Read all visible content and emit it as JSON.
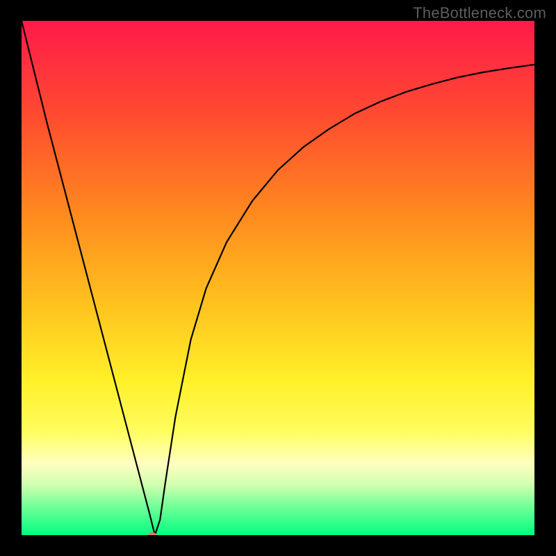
{
  "watermark": "TheBottleneck.com",
  "chart_data": {
    "type": "line",
    "title": "",
    "xlabel": "",
    "ylabel": "",
    "xlim": [
      0,
      100
    ],
    "ylim": [
      0,
      100
    ],
    "grid": false,
    "background_gradient": {
      "stops": [
        {
          "offset": 0.0,
          "color": "#ff1a4a"
        },
        {
          "offset": 0.18,
          "color": "#ff4a30"
        },
        {
          "offset": 0.38,
          "color": "#ff8b1e"
        },
        {
          "offset": 0.55,
          "color": "#ffc21e"
        },
        {
          "offset": 0.7,
          "color": "#fff028"
        },
        {
          "offset": 0.8,
          "color": "#fffd60"
        },
        {
          "offset": 0.86,
          "color": "#ffffc0"
        },
        {
          "offset": 0.9,
          "color": "#d4ffb0"
        },
        {
          "offset": 0.94,
          "color": "#7cff9a"
        },
        {
          "offset": 1.0,
          "color": "#00ff80"
        }
      ]
    },
    "series": [
      {
        "name": "bottleneck-curve",
        "x": [
          0,
          5,
          10,
          15,
          20,
          25,
          26,
          27,
          28,
          30,
          33,
          36,
          40,
          45,
          50,
          55,
          60,
          65,
          70,
          75,
          80,
          85,
          90,
          95,
          100
        ],
        "y": [
          100,
          80,
          61,
          42,
          23,
          4,
          0,
          3,
          10,
          23,
          38,
          48,
          57,
          65,
          71,
          75.5,
          79,
          82,
          84.3,
          86.2,
          87.7,
          89,
          90,
          90.8,
          91.5
        ]
      }
    ],
    "marker": {
      "x": 25.5,
      "y": 0,
      "color": "#d97c65",
      "rx": 6,
      "ry": 4.3
    }
  }
}
